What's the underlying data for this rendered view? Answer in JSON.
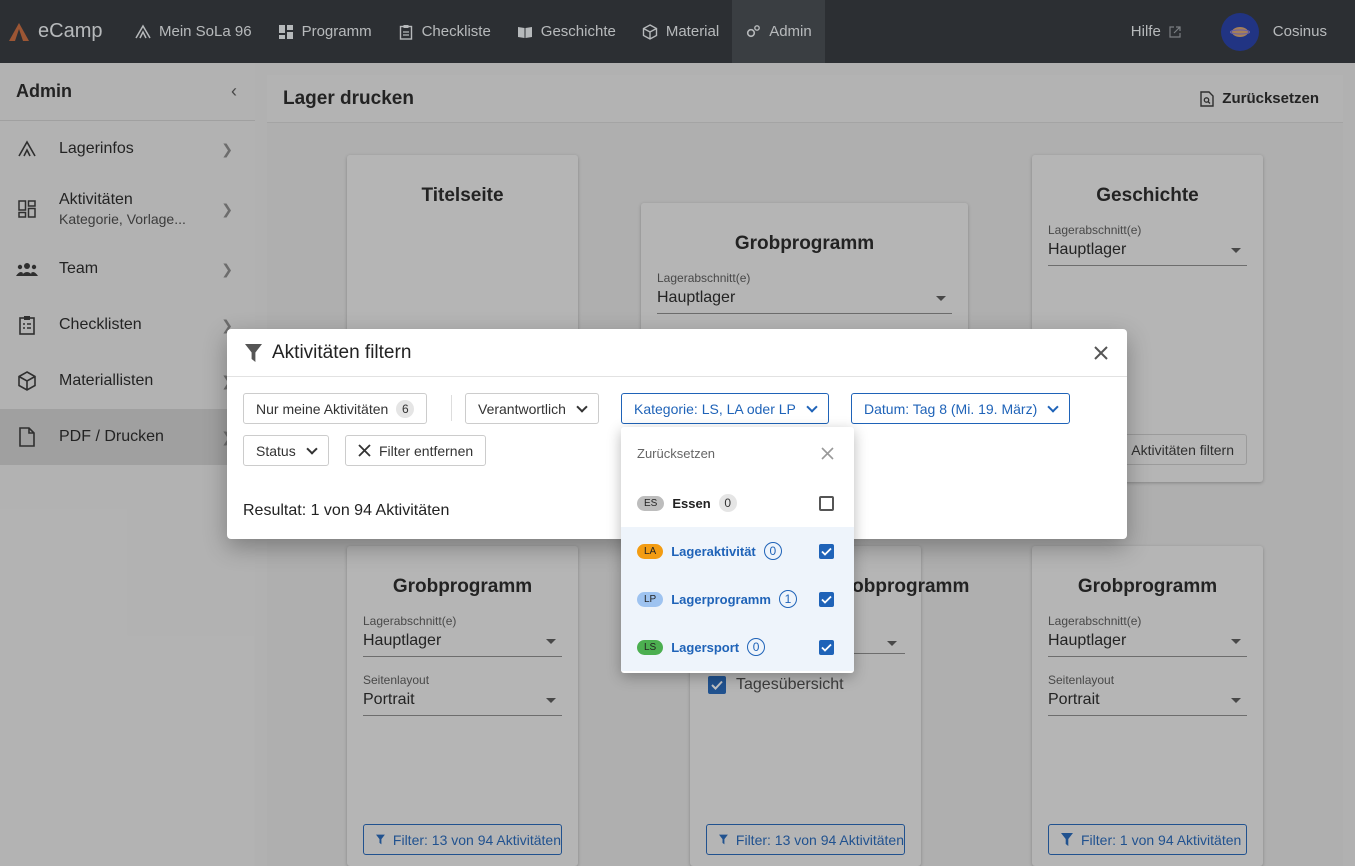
{
  "topnav": {
    "brand": "eCamp",
    "items": [
      {
        "label": "Mein SoLa 96",
        "icon": "tent-icon"
      },
      {
        "label": "Programm",
        "icon": "grid-icon"
      },
      {
        "label": "Checkliste",
        "icon": "clipboard-icon"
      },
      {
        "label": "Geschichte",
        "icon": "book-icon"
      },
      {
        "label": "Material",
        "icon": "package-icon"
      },
      {
        "label": "Admin",
        "icon": "gears-icon"
      }
    ],
    "help": "Hilfe",
    "user": "Cosinus"
  },
  "sidebar": {
    "title": "Admin",
    "items": [
      {
        "label": "Lagerinfos",
        "sub": ""
      },
      {
        "label": "Aktivitäten",
        "sub": "Kategorie, Vorlage..."
      },
      {
        "label": "Team",
        "sub": ""
      },
      {
        "label": "Checklisten",
        "sub": ""
      },
      {
        "label": "Materiallisten",
        "sub": ""
      },
      {
        "label": "PDF / Drucken",
        "sub": ""
      }
    ]
  },
  "main": {
    "title": "Lager drucken",
    "reset": "Zurücksetzen",
    "cards": {
      "titelseite": "Titelseite",
      "grob1": {
        "title": "Grobprogramm",
        "label": "Lagerabschnitt(e)",
        "value": "Hauptlager"
      },
      "geschichte": {
        "title": "Geschichte",
        "label": "Lagerabschnitt(e)",
        "value": "Hauptlager",
        "button": "Aktivitäten filtern"
      },
      "grob2": {
        "title": "Grobprogramm",
        "label1": "Lagerabschnitt(e)",
        "value1": "Hauptlager",
        "label2": "Seitenlayout",
        "value2": "Portrait",
        "filter": "Filter: 13 von 94 Aktivitäten"
      },
      "mid": {
        "title": "Grobprogramm",
        "checkbox": "Tagesübersicht",
        "filter": "Filter: 13 von 94 Aktivitäten"
      },
      "grob3": {
        "title": "Grobprogramm",
        "label1": "Lagerabschnitt(e)",
        "value1": "Hauptlager",
        "label2": "Seitenlayout",
        "value2": "Portrait",
        "filter": "Filter: 1 von 94 Aktivitäten"
      }
    }
  },
  "dialog": {
    "title": "Aktivitäten filtern",
    "chips": {
      "mine": "Nur meine Aktivitäten",
      "mine_count": "6",
      "responsible": "Verantwortlich",
      "category": "Kategorie: LS, LA oder LP",
      "date": "Datum: Tag 8 (Mi. 19. März)",
      "status": "Status",
      "remove": "Filter entfernen"
    },
    "result": "Resultat: 1 von 94 Aktivitäten"
  },
  "dropdown": {
    "reset": "Zurücksetzen",
    "options": [
      {
        "tag": "ES",
        "label": "Essen",
        "count": "0",
        "checked": false,
        "color": "#bdbdbd"
      },
      {
        "tag": "LA",
        "label": "Lageraktivität",
        "count": "0",
        "checked": true,
        "color": "#f39c12"
      },
      {
        "tag": "LP",
        "label": "Lagerprogramm",
        "count": "1",
        "checked": true,
        "color": "#9ec3f0"
      },
      {
        "tag": "LS",
        "label": "Lagersport",
        "count": "0",
        "checked": true,
        "color": "#4caf50"
      }
    ]
  }
}
